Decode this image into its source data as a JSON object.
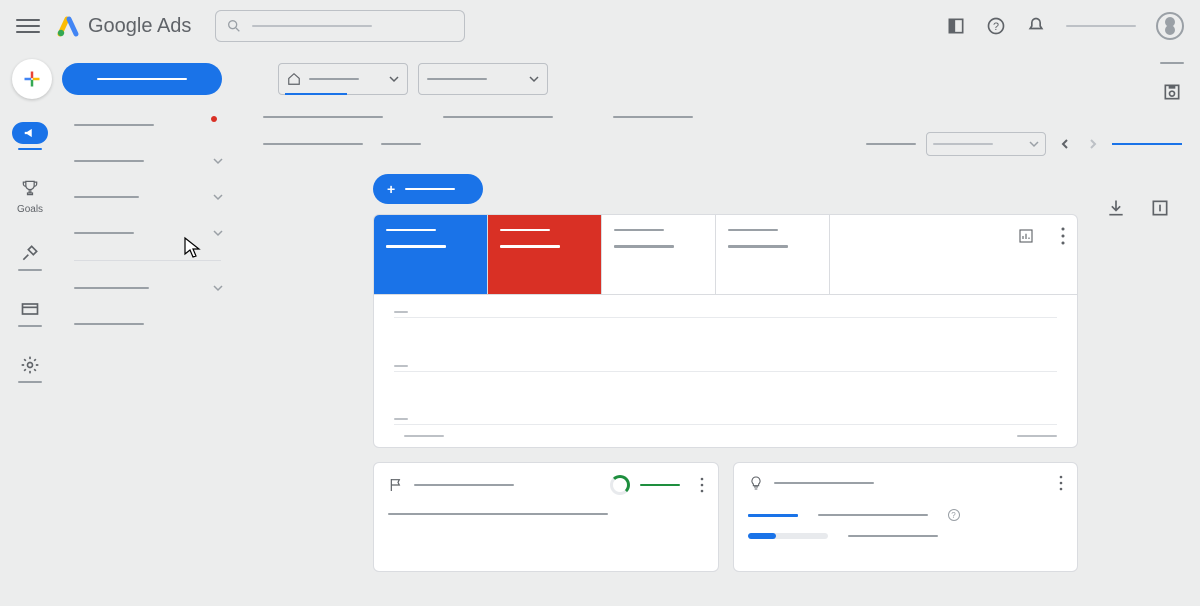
{
  "header": {
    "product_name": "Google Ads",
    "search_placeholder": "",
    "account_label": ""
  },
  "toprow": {
    "primary_button_label": "",
    "dropdown1": {
      "label": "",
      "icon": "home"
    },
    "dropdown2": {
      "label": ""
    }
  },
  "iconrail": {
    "items": [
      {
        "id": "campaigns",
        "label": "",
        "active": true
      },
      {
        "id": "goals",
        "label": "Goals"
      },
      {
        "id": "tools",
        "label": ""
      },
      {
        "id": "billing",
        "label": ""
      },
      {
        "id": "admin",
        "label": ""
      }
    ]
  },
  "sidebar": {
    "items": [
      {
        "label": "",
        "hasAlert": true
      },
      {
        "label": "",
        "expandable": true
      },
      {
        "label": "",
        "expandable": true
      },
      {
        "label": "",
        "expandable": true
      },
      {
        "label": "",
        "expandable": true
      },
      {
        "label": ""
      }
    ]
  },
  "main": {
    "breadcrumb": [
      "",
      "",
      ""
    ],
    "subnav": [
      "",
      ""
    ],
    "date_range": "",
    "add_button_label": "",
    "scorecards": [
      {
        "metric": "",
        "value": "",
        "color": "blue"
      },
      {
        "metric": "",
        "value": "",
        "color": "red"
      },
      {
        "metric": "",
        "value": "",
        "color": "plain"
      },
      {
        "metric": "",
        "value": "",
        "color": "plain"
      }
    ],
    "chart_ticks": [
      "",
      ""
    ],
    "bottom_cards": [
      {
        "title": "",
        "status": "",
        "body": ""
      },
      {
        "title": "",
        "metric1": "",
        "metric2": "",
        "progress": 35
      }
    ]
  },
  "colors": {
    "primary": "#1a73e8",
    "danger": "#d93025",
    "success": "#1e8e3e",
    "grey": "#9aa0a6"
  }
}
